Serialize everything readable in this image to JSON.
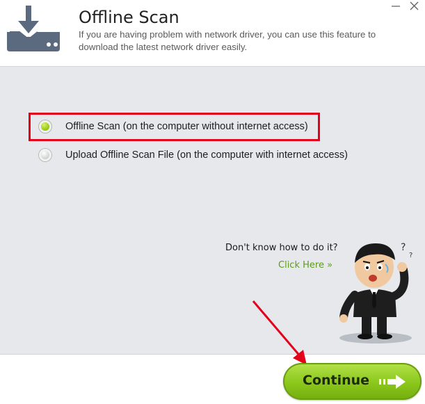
{
  "header": {
    "title": "Offline Scan",
    "description": "If you are having problem with network driver, you can use this feature to download the latest network driver easily.",
    "icon": "download-drive-icon",
    "window_controls": [
      "minimize-icon",
      "close-icon"
    ]
  },
  "options": [
    {
      "label": "Offline Scan (on the computer without internet access)",
      "selected": true
    },
    {
      "label": "Upload Offline Scan File (on the computer with internet access)",
      "selected": false
    }
  ],
  "help": {
    "question": "Don't know how to do it?",
    "link": "Click Here »"
  },
  "footer": {
    "continue_label": "Continue"
  },
  "colors": {
    "accent_green": "#8ac71b",
    "annotation_red": "#e3001b",
    "link_green": "#5c9c18",
    "icon_slate": "#5b6a7e"
  }
}
